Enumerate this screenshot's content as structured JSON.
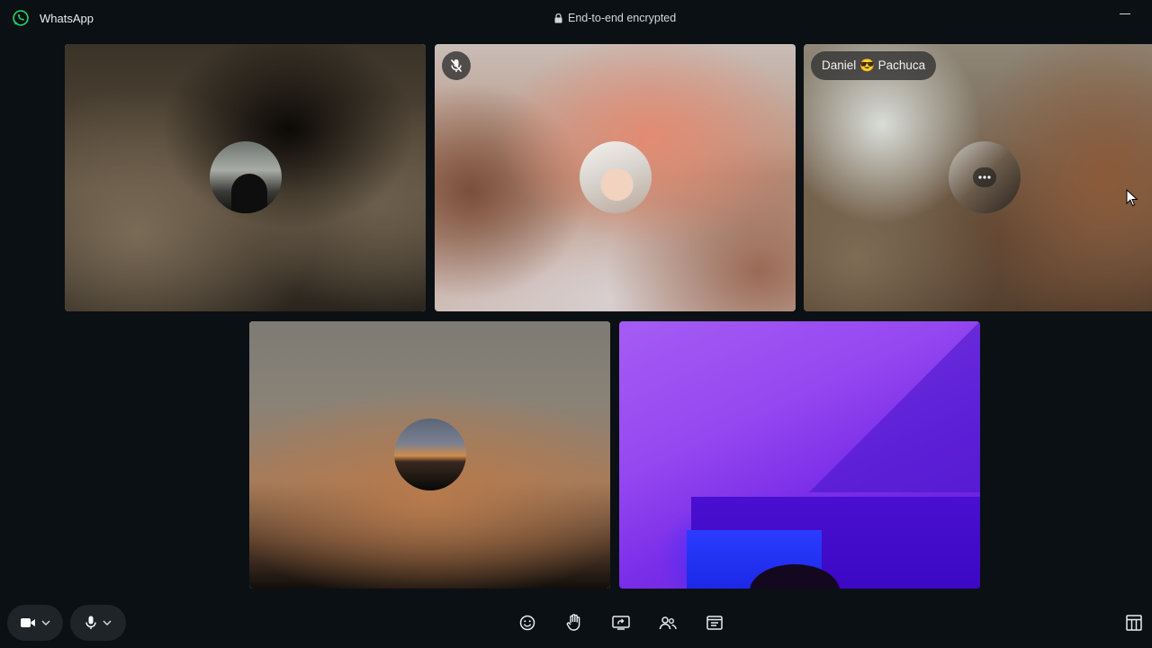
{
  "window": {
    "app_name": "WhatsApp",
    "encryption_label": "End-to-end encrypted"
  },
  "tiles": [
    {
      "id": "participant-1",
      "active": true
    },
    {
      "id": "participant-2",
      "muted": true
    },
    {
      "id": "participant-3",
      "name_chip": "Daniel 😎 Pachuca"
    },
    {
      "id": "participant-4",
      "active": true
    },
    {
      "id": "participant-5",
      "video_on": true
    }
  ],
  "toolbar": {
    "left": [
      "video-camera-icon",
      "chevron-down-icon",
      "microphone-icon",
      "chevron-down-icon"
    ],
    "center": [
      "emoji-reaction-icon",
      "raise-hand-icon",
      "share-screen-icon",
      "participants-icon",
      "captions-icon"
    ],
    "right": [
      "layout-icon"
    ]
  },
  "colors": {
    "background": "#0b1014",
    "whatsapp_green": "#25d366",
    "active_border": "#ffffff"
  }
}
